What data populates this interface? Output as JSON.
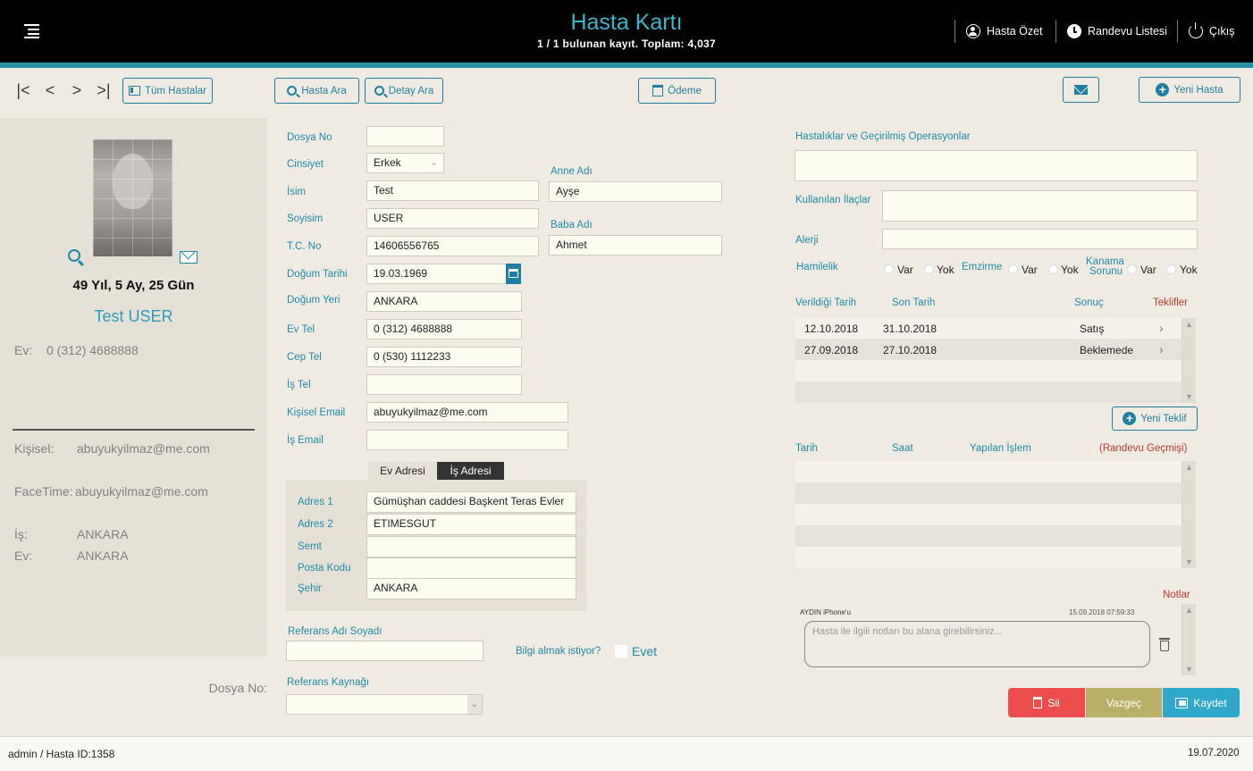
{
  "header": {
    "title": "Hasta Kartı",
    "subtitle": "1 / 1 bulunan kayıt. Toplam: 4,037",
    "buttons": {
      "summary": "Hasta Özet",
      "appointments": "Randevu Listesi",
      "logout": "Çıkış"
    }
  },
  "toolbar": {
    "all_patients": "Tüm Hastalar",
    "patient_search": "Hasta  Ara",
    "detail_search": "Detay Ara",
    "payment": "Ödeme",
    "new_patient": "Yeni Hasta"
  },
  "left_panel": {
    "age": "49 Yıl, 5 Ay, 25 Gün",
    "name": "Test USER",
    "home_phone_label": "Ev:",
    "home_phone": "0 (312) 4688888",
    "personal_label": "Kişisel:",
    "personal_email": "abuyukyilmaz@me.com",
    "facetime_label": "FaceTime:",
    "facetime": "abuyukyilmaz@me.com",
    "work_label": "İş:",
    "work_city": "ANKARA",
    "home_label": "Ev:",
    "home_city": "ANKARA",
    "file_no_label": "Dosya No:"
  },
  "form": {
    "file_no": {
      "label": "Dosya No",
      "value": ""
    },
    "gender": {
      "label": "Cinsiyet",
      "value": "Erkek"
    },
    "first_name": {
      "label": "İsim",
      "value": "Test"
    },
    "last_name": {
      "label": "Soyisim",
      "value": "USER"
    },
    "tc_no": {
      "label": "T.C. No",
      "value": "14606556765"
    },
    "birth_date": {
      "label": "Doğum Tarihi",
      "value": "19.03.1969"
    },
    "birth_place": {
      "label": "Doğum Yeri",
      "value": "ANKARA"
    },
    "home_tel": {
      "label": "Ev Tel",
      "value": "0 (312) 4688888"
    },
    "mobile_tel": {
      "label": "Cep Tel",
      "value": "0 (530) 1112233"
    },
    "work_tel": {
      "label": "İş Tel",
      "value": ""
    },
    "personal_email": {
      "label": "Kişisel Email",
      "value": "abuyukyilmaz@me.com"
    },
    "work_email": {
      "label": "İş Email",
      "value": ""
    },
    "mother_name": {
      "label": "Anne Adı",
      "value": "Ayşe"
    },
    "father_name": {
      "label": "Baba Adı",
      "value": "Ahmet"
    }
  },
  "address": {
    "tabs": [
      "Ev Adresi",
      "İş Adresi"
    ],
    "address1": {
      "label": "Adres 1",
      "value": "Gümüşhan caddesi Başkent Teras Evler"
    },
    "address2": {
      "label": "Adres 2",
      "value": "ETIMESGUT"
    },
    "district": {
      "label": "Semt",
      "value": ""
    },
    "postal_code": {
      "label": "Posta Kodu",
      "value": ""
    },
    "city": {
      "label": "Şehir",
      "value": "ANKARA"
    }
  },
  "referral": {
    "name_label": "Referans Adı Soyadı",
    "name_value": "",
    "info_label": "Bilgi almak istiyor?",
    "info_option": "Evet",
    "source_label": "Referans Kaynağı",
    "source_value": ""
  },
  "medical": {
    "diseases_label": "Hastalıklar ve Geçirilmiş Operasyonlar",
    "medications_label": "Kullanılan İlaçlar",
    "allergy_label": "Alerji",
    "pregnancy_label": "Hamilelik",
    "breastfeeding_label": "Emzirme",
    "bleeding_label_1": "Kanama",
    "bleeding_label_2": "Sorunu",
    "yes": "Var",
    "no": "Yok"
  },
  "offers": {
    "headers": [
      "Verildiği Tarih",
      "Son Tarih",
      "Sonuç"
    ],
    "title": "Teklifler",
    "rows": [
      {
        "date": "12.10.2018",
        "end": "31.10.2018",
        "result": "Satış"
      },
      {
        "date": "27.09.2018",
        "end": "27.10.2018",
        "result": "Beklemede"
      }
    ],
    "new_offer": "Yeni Teklif"
  },
  "appointments": {
    "headers": [
      "Tarih",
      "Saat",
      "Yapılan İşlem"
    ],
    "title": "(Randevu Geçmişi)"
  },
  "notes": {
    "title": "Notlar",
    "author": "AYDIN iPhone'u",
    "timestamp": "15.09.2018 07:59:33",
    "placeholder": "Hasta ile ilgili notları bu alana girebilirsiniz..."
  },
  "actions": {
    "delete": "Sil",
    "cancel": "Vazgeç",
    "save": "Kaydet"
  },
  "footer": {
    "user": "admin / Hasta ID:",
    "patient_id": "1358",
    "date": "19.07.2020"
  },
  "colors": {
    "accent": "#1f8aa8",
    "header_bg": "#000000",
    "delete": "#ec4d4d",
    "cancel": "#b8b068",
    "save": "#2fa8c9"
  }
}
